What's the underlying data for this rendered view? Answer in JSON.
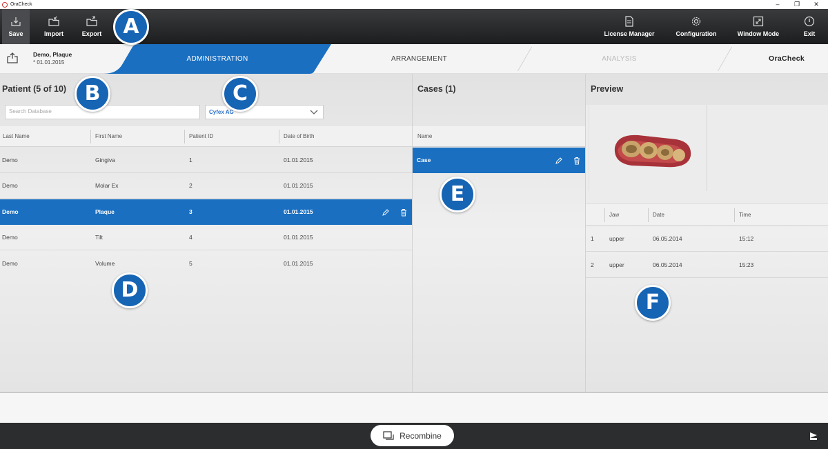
{
  "window": {
    "title": "OraCheck",
    "minimize": "–",
    "restore": "❐",
    "close": "✕"
  },
  "toolbar": {
    "save": "Save",
    "import": "Import",
    "export": "Export",
    "license_manager": "License Manager",
    "configuration": "Configuration",
    "window_mode": "Window Mode",
    "exit": "Exit"
  },
  "case": {
    "name": "Demo, Plaque",
    "dob": "* 01.01.2015"
  },
  "tabs": {
    "administration": "ADMINISTRATION",
    "arrangement": "ARRANGEMENT",
    "analysis": "ANALYSIS",
    "product": "OraCheck"
  },
  "patients": {
    "title": "Patient (5 of 10)",
    "search_placeholder": "Search Database",
    "group_selected": "Cyfex AG",
    "columns": [
      "Last Name",
      "First Name",
      "Patient ID",
      "Date of Birth"
    ],
    "rows": [
      {
        "last": "Demo",
        "first": "Gingiva",
        "id": "1",
        "dob": "01.01.2015"
      },
      {
        "last": "Demo",
        "first": "Molar Ex",
        "id": "2",
        "dob": "01.01.2015"
      },
      {
        "last": "Demo",
        "first": "Plaque",
        "id": "3",
        "dob": "01.01.2015"
      },
      {
        "last": "Demo",
        "first": "Tilt",
        "id": "4",
        "dob": "01.01.2015"
      },
      {
        "last": "Demo",
        "first": "Volume",
        "id": "5",
        "dob": "01.01.2015"
      }
    ],
    "selected_index": 2
  },
  "cases": {
    "title": "Cases (1)",
    "column": "Name",
    "rows": [
      {
        "name": "Case"
      }
    ]
  },
  "preview": {
    "title": "Preview",
    "columns": [
      "Jaw",
      "Date",
      "Time"
    ],
    "rows": [
      {
        "n": "1",
        "jaw": "upper",
        "date": "06.05.2014",
        "time": "15:12"
      },
      {
        "n": "2",
        "jaw": "upper",
        "date": "06.05.2014",
        "time": "15:23"
      }
    ]
  },
  "bottom": {
    "recombine": "Recombine"
  },
  "callouts": {
    "a": "A",
    "b": "B",
    "c": "C",
    "d": "D",
    "e": "E",
    "f": "F"
  },
  "colors": {
    "accent": "#1a6fc1",
    "toolbar": "#2a2b2d",
    "badge": "#1664b4"
  }
}
